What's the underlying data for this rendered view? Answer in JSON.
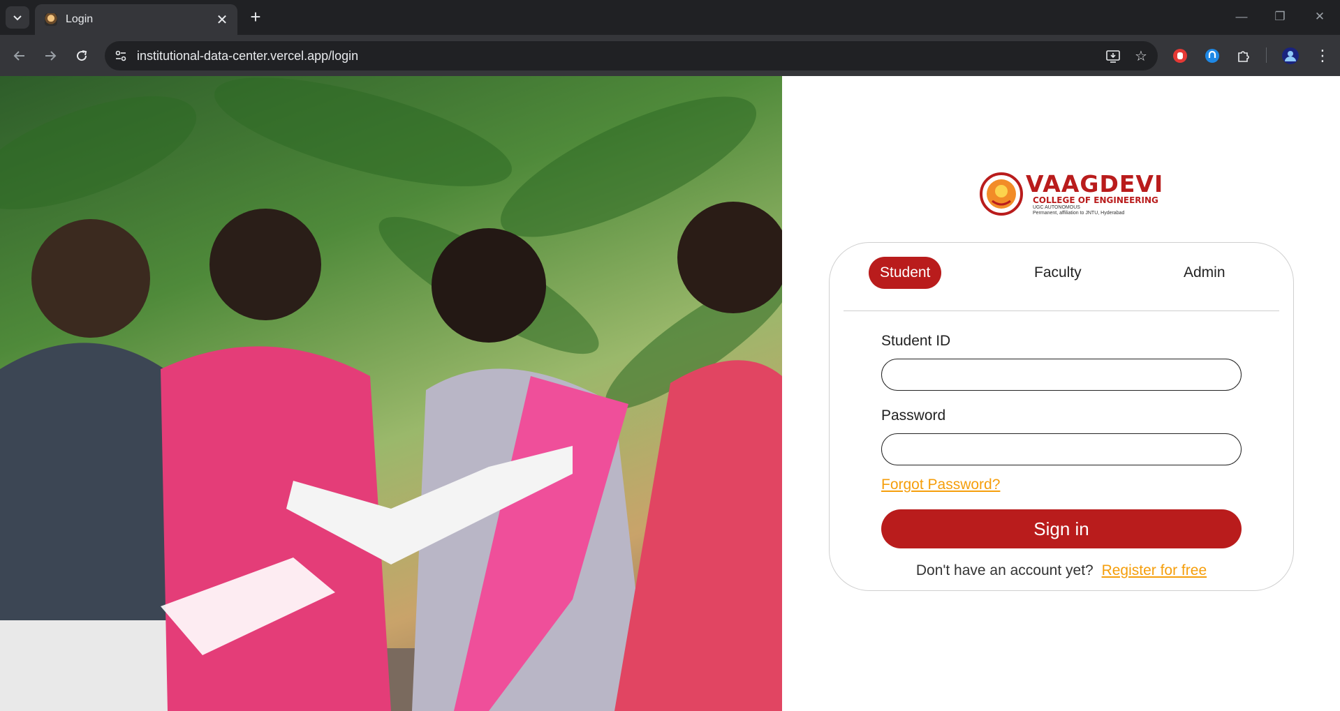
{
  "browser": {
    "tab_title": "Login",
    "url": "institutional-data-center.vercel.app/login"
  },
  "page": {
    "logo": {
      "name": "VAAGDEVI",
      "subtitle": "COLLEGE OF ENGINEERING",
      "line1": "UGC AUTONOMOUS",
      "line2": "Permanent, affiliation to JNTU, Hyderabad"
    },
    "roles": [
      "Student",
      "Faculty",
      "Admin"
    ],
    "selected_role": "Student",
    "form": {
      "id_label": "Student ID",
      "id_value": "",
      "password_label": "Password",
      "password_value": "",
      "forgot_label": "Forgot Password?",
      "submit_label": "Sign in",
      "register_prompt": "Don't have an account yet?",
      "register_link": "Register for free"
    },
    "colors": {
      "brand": "#b91c1c",
      "link": "#f59e0b"
    }
  }
}
